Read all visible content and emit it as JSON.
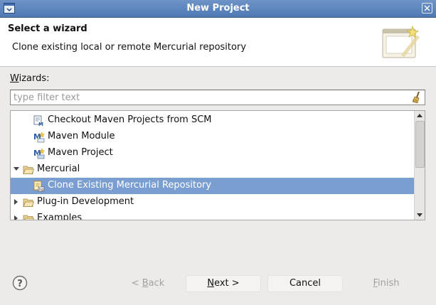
{
  "window": {
    "title": "New Project"
  },
  "banner": {
    "title": "Select a wizard",
    "description": "Clone existing local or remote Mercurial repository"
  },
  "wizards": {
    "label_mnemonic": "W",
    "label_rest": "izards:",
    "filter_placeholder": "type filter text",
    "filter_value": ""
  },
  "tree": {
    "items": [
      {
        "label": "Checkout Maven Projects from SCM",
        "icon": "maven-scm-icon",
        "level": 1,
        "expander": "none",
        "selected": false
      },
      {
        "label": "Maven Module",
        "icon": "maven-module-icon",
        "level": 1,
        "expander": "none",
        "selected": false
      },
      {
        "label": "Maven Project",
        "icon": "maven-project-icon",
        "level": 1,
        "expander": "none",
        "selected": false
      },
      {
        "label": "Mercurial",
        "icon": "folder-open-icon",
        "level": 0,
        "expander": "expanded",
        "selected": false
      },
      {
        "label": "Clone Existing Mercurial Repository",
        "icon": "mercurial-clone-icon",
        "level": 1,
        "expander": "none",
        "selected": true
      },
      {
        "label": "Plug-in Development",
        "icon": "folder-icon",
        "level": 0,
        "expander": "collapsed",
        "selected": false
      },
      {
        "label": "Examples",
        "icon": "folder-icon",
        "level": 0,
        "expander": "collapsed",
        "selected": false
      }
    ]
  },
  "buttons": {
    "back_mnemonic": "B",
    "back_rest": "ack",
    "back_prefix": "< ",
    "next_mnemonic": "N",
    "next_rest": "ext >",
    "cancel": "Cancel",
    "finish_mnemonic": "F",
    "finish_rest": "inish"
  },
  "colors": {
    "selection": "#7b9ed0",
    "titlebar": "#5a82bc",
    "dialog_bg": "#ecebe9"
  }
}
